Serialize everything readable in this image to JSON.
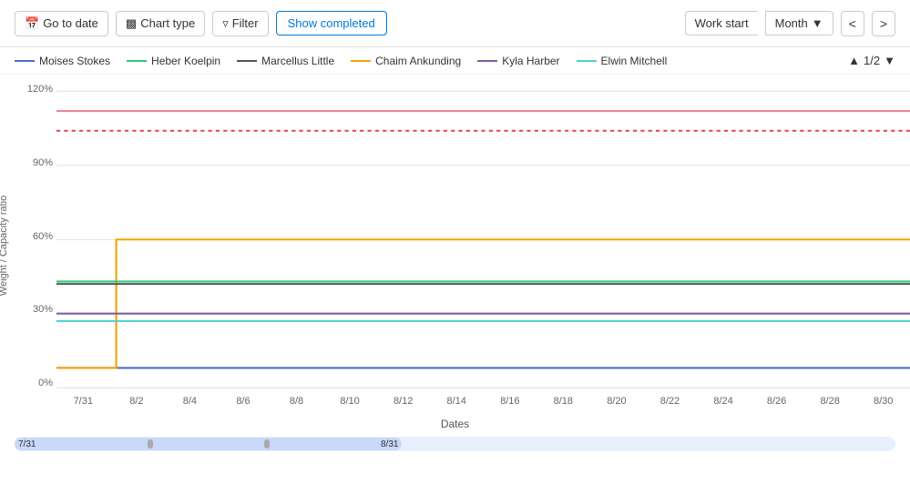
{
  "toolbar": {
    "go_to_date": "Go to date",
    "chart_type": "Chart type",
    "filter": "Filter",
    "show_completed": "Show completed",
    "work_start": "Work start",
    "month": "Month",
    "nav_prev": "<",
    "nav_next": ">"
  },
  "legend": {
    "items": [
      {
        "name": "Moises Stokes",
        "color": "#4472C4"
      },
      {
        "name": "Heber Koelpin",
        "color": "#2ECC71"
      },
      {
        "name": "Marcellus Little",
        "color": "#555"
      },
      {
        "name": "Chaim Ankunding",
        "color": "#F0A500"
      },
      {
        "name": "Kyla Harber",
        "color": "#7B5EA7"
      },
      {
        "name": "Elwin Mitchell",
        "color": "#4DD0D0"
      }
    ],
    "pagination": "1/2"
  },
  "yAxis": {
    "labels": [
      "120%",
      "90%",
      "60%",
      "30%",
      "0%"
    ],
    "title": "Weight / Capacity ratio"
  },
  "xAxis": {
    "labels": [
      "7/31",
      "8/2",
      "8/4",
      "8/6",
      "8/8",
      "8/10",
      "8/12",
      "8/14",
      "8/16",
      "8/18",
      "8/20",
      "8/22",
      "8/24",
      "8/26",
      "8/28",
      "8/30"
    ],
    "title": "Dates"
  },
  "scrollbar": {
    "start_label": "7/31",
    "end_label": "8/31"
  },
  "chart": {
    "lines": [
      {
        "name": "pink_solid",
        "color": "#E88",
        "dash": "none",
        "y_pct": 112,
        "start_x_pct": 0
      },
      {
        "name": "red_dotted",
        "color": "#E44",
        "dash": "dotted",
        "y_pct": 104,
        "start_x_pct": 0
      },
      {
        "name": "moises",
        "color": "#4472C4",
        "y_start_pct": 8,
        "y_end_pct": 8,
        "start_x_pct": 0,
        "elbow_x_pct": 8
      },
      {
        "name": "chaim",
        "color": "#F0A500",
        "y_start_pct": 8,
        "y_end_pct": 60,
        "start_x_pct": 0,
        "elbow_x_pct": 8
      },
      {
        "name": "heber",
        "color": "#2ECC71",
        "y_pct": 43,
        "start_x_pct": 0
      },
      {
        "name": "marcellus",
        "color": "#444",
        "y_pct": 43,
        "start_x_pct": 0
      },
      {
        "name": "kyla",
        "color": "#7B5EA7",
        "y_pct": 30,
        "start_x_pct": 0
      },
      {
        "name": "elwin",
        "color": "#4DD0D0",
        "y_pct": 27,
        "start_x_pct": 0
      }
    ]
  }
}
